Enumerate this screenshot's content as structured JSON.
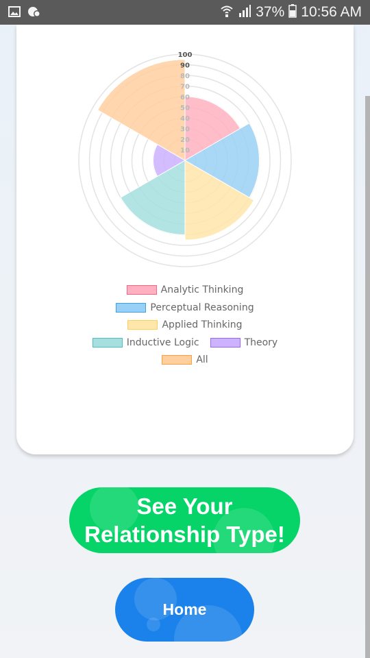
{
  "status_bar": {
    "battery": "37%",
    "time": "10:56 AM",
    "icons": [
      "image-icon",
      "notification-badge-icon",
      "wifi-icon",
      "signal-icon",
      "battery-icon"
    ]
  },
  "chart_data": {
    "type": "polarArea",
    "categories": [
      "Analytic Thinking",
      "Perceptual Reasoning",
      "Applied Thinking",
      "Inductive Logic",
      "Theory",
      "All"
    ],
    "values": [
      60,
      70,
      75,
      70,
      30,
      95
    ],
    "colors": [
      "#ffb1c1",
      "#9ad0f5",
      "#ffe6aa",
      "#a5dfdf",
      "#ccb2ff",
      "#ffcf9f"
    ],
    "r_ticks": [
      "10",
      "20",
      "30",
      "40",
      "50",
      "60",
      "70",
      "80",
      "90",
      "100"
    ],
    "rlim": [
      0,
      100
    ],
    "legend": "bottom"
  },
  "buttons": {
    "relationship_line1": "See Your",
    "relationship_line2": "Relationship Type!",
    "home": "Home"
  }
}
